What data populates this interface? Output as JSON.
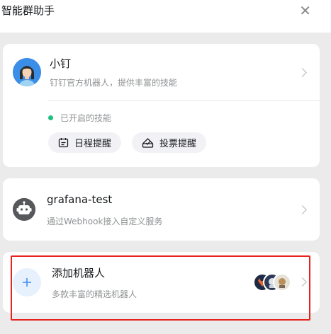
{
  "window": {
    "title": "智能群助手",
    "close_icon": "close-icon"
  },
  "bots": [
    {
      "name": "小钉",
      "description": "钉钉官方机器人，提供丰富的技能",
      "avatar_icon": "girl-avatar",
      "enabled_skills_label": "已开启的技能",
      "status_color": "#1fbf7f",
      "skills": [
        {
          "label": "日程提醒",
          "icon": "calendar-icon"
        },
        {
          "label": "投票提醒",
          "icon": "vote-icon"
        }
      ]
    },
    {
      "name": "grafana-test",
      "description": "通过Webhook接入自定义服务",
      "avatar_icon": "robot-icon"
    }
  ],
  "add_bot": {
    "name": "添加机器人",
    "description": "多款丰富的精选机器人",
    "icon": "plus-icon",
    "preview_icons": [
      "gitlab-avatar",
      "jenkins-avatar",
      "bot-avatar"
    ]
  },
  "highlight_color": "#e8231f"
}
